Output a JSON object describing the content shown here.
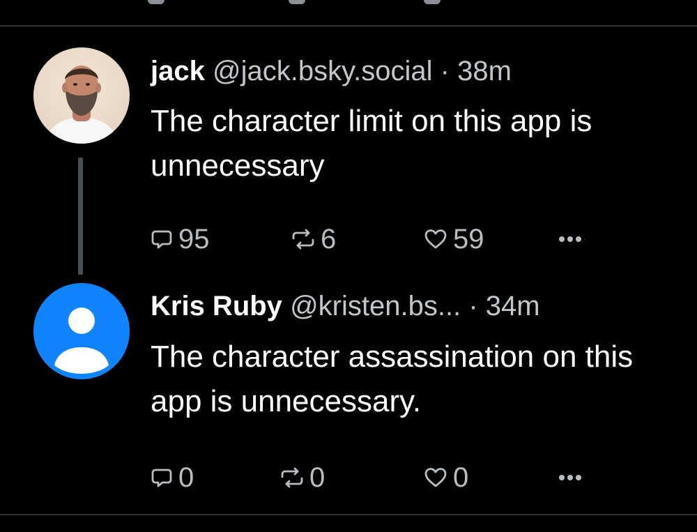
{
  "thread": {
    "parent": {
      "display_name": "jack",
      "handle": "@jack.bsky.social",
      "separator": "·",
      "time": "38m",
      "text": "The character limit on this app is unnecessary",
      "reply_count": "95",
      "repost_count": "6",
      "like_count": "59"
    },
    "reply": {
      "display_name": "Kris Ruby",
      "handle": "@kristen.bs...",
      "separator": "·",
      "time": "34m",
      "text": "The character assassination on this app is unnecessary.",
      "reply_count": "0",
      "repost_count": "0",
      "like_count": "0"
    }
  },
  "colors": {
    "background": "#000000",
    "text_primary": "#ffffff",
    "text_secondary": "#c2c7cc",
    "icon": "#b8bdc2",
    "divider": "#2e3439",
    "thread_line": "#4a4f54",
    "default_avatar": "#1083fe"
  },
  "icons": {
    "reply": "reply-icon",
    "repost": "repost-icon",
    "like": "heart-icon",
    "more": "more-options-icon",
    "default_avatar": "default-avatar-icon"
  }
}
